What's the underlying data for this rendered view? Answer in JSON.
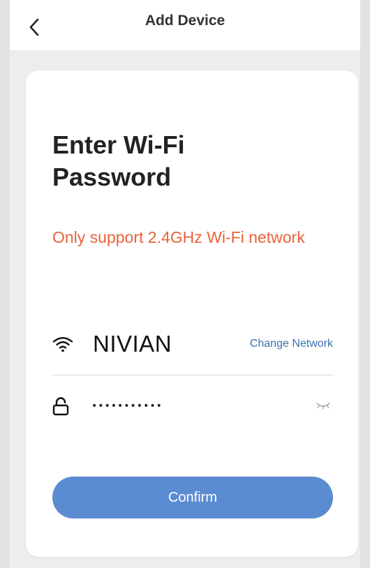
{
  "header": {
    "title": "Add Device",
    "back_icon": "chevron-left-icon"
  },
  "card": {
    "heading": "Enter Wi-Fi Password",
    "notice": "Only support 2.4GHz Wi-Fi network",
    "network": {
      "icon": "wifi-icon",
      "ssid": "NIVIAN",
      "change_label": "Change Network"
    },
    "password": {
      "icon": "lock-icon",
      "value": "•••••••••••",
      "visibility_icon": "eye-closed-icon"
    },
    "confirm_label": "Confirm"
  },
  "colors": {
    "accent": "#5b8bd0",
    "notice": "#e8633a",
    "link": "#3a6fb0",
    "background": "#ededed"
  }
}
